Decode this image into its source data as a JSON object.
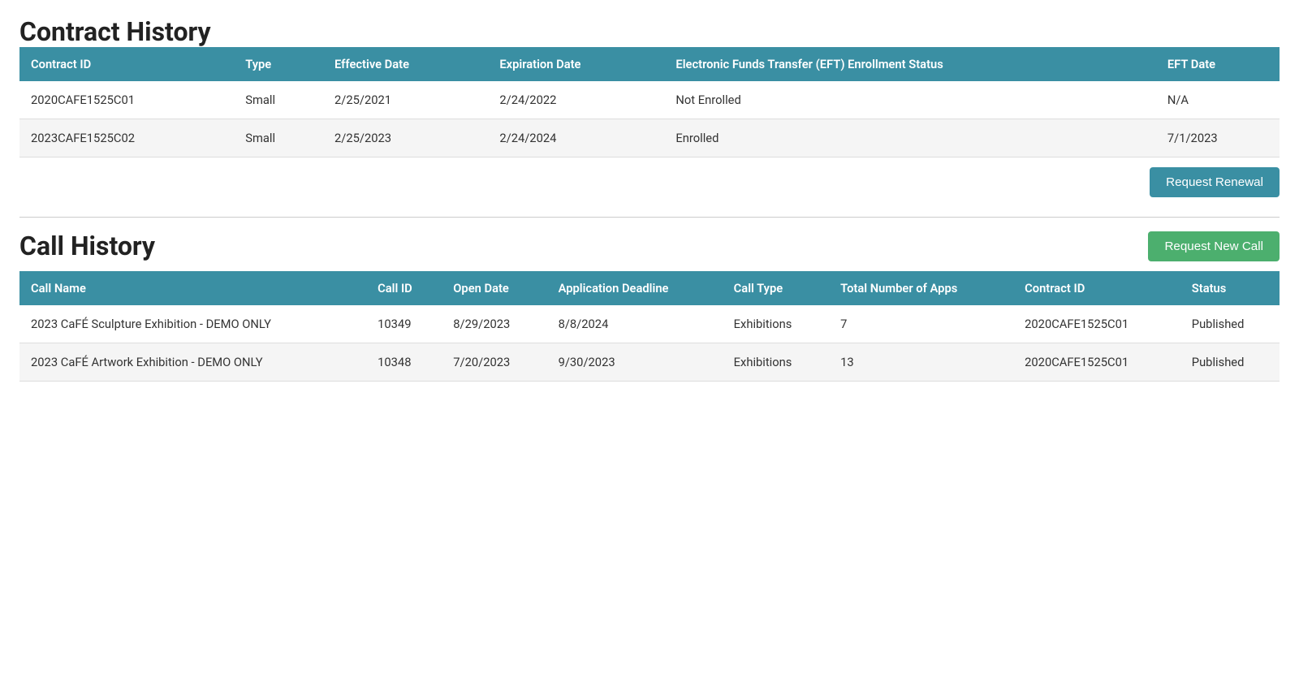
{
  "contract_history": {
    "title": "Contract History",
    "columns": [
      "Contract ID",
      "Type",
      "Effective Date",
      "Expiration Date",
      "Electronic Funds Transfer (EFT) Enrollment Status",
      "EFT Date"
    ],
    "rows": [
      {
        "contract_id": "2020CAFE1525C01",
        "type": "Small",
        "effective_date": "2/25/2021",
        "expiration_date": "2/24/2022",
        "eft_status": "Not Enrolled",
        "eft_date": "N/A"
      },
      {
        "contract_id": "2023CAFE1525C02",
        "type": "Small",
        "effective_date": "2/25/2023",
        "expiration_date": "2/24/2024",
        "eft_status": "Enrolled",
        "eft_date": "7/1/2023"
      }
    ],
    "renewal_button_label": "Request Renewal"
  },
  "call_history": {
    "title": "Call History",
    "new_call_button_label": "Request New Call",
    "columns": [
      "Call Name",
      "Call ID",
      "Open Date",
      "Application Deadline",
      "Call Type",
      "Total Number of Apps",
      "Contract ID",
      "Status"
    ],
    "rows": [
      {
        "call_name": "2023 CaFÉ Sculpture Exhibition - DEMO ONLY",
        "call_id": "10349",
        "open_date": "8/29/2023",
        "application_deadline": "8/8/2024",
        "call_type": "Exhibitions",
        "total_apps": "7",
        "contract_id": "2020CAFE1525C01",
        "status": "Published"
      },
      {
        "call_name": "2023 CaFÉ Artwork Exhibition - DEMO ONLY",
        "call_id": "10348",
        "open_date": "7/20/2023",
        "application_deadline": "9/30/2023",
        "call_type": "Exhibitions",
        "total_apps": "13",
        "contract_id": "2020CAFE1525C01",
        "status": "Published"
      }
    ]
  }
}
